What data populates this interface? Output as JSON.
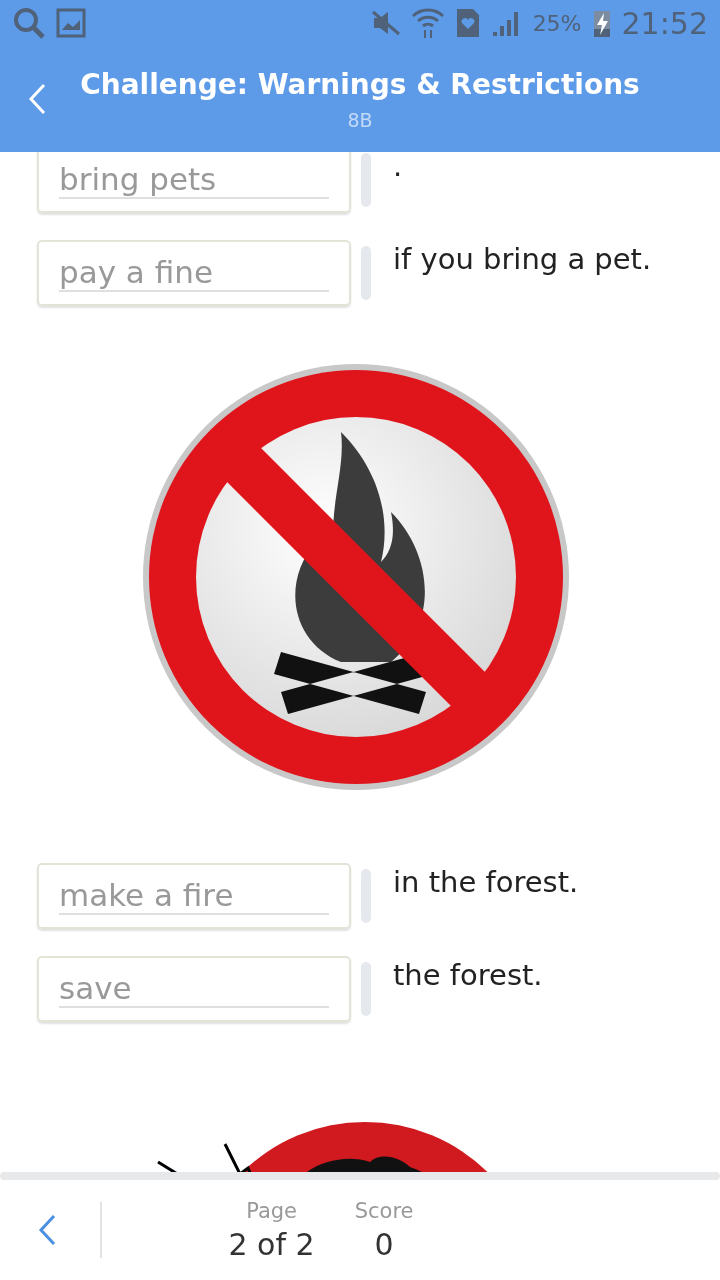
{
  "status_bar": {
    "battery": "25%",
    "time": "21:52"
  },
  "header": {
    "title": "Challenge: Warnings & Restrictions",
    "subtitle": "8B"
  },
  "items": [
    {
      "kind": "gap",
      "value": "bring pets",
      "text": "."
    },
    {
      "kind": "gap",
      "value": "pay a fine",
      "text": "if you bring a pet."
    },
    {
      "kind": "no-fire-sign"
    },
    {
      "kind": "gap",
      "value": "make a fire",
      "text": "in the forest."
    },
    {
      "kind": "gap",
      "value": "save",
      "text": "the forest."
    },
    {
      "kind": "cartoon-sign"
    }
  ],
  "footer": {
    "page_label": "Page",
    "page_value": "2 of 2",
    "score_label": "Score",
    "score_value": "0"
  }
}
